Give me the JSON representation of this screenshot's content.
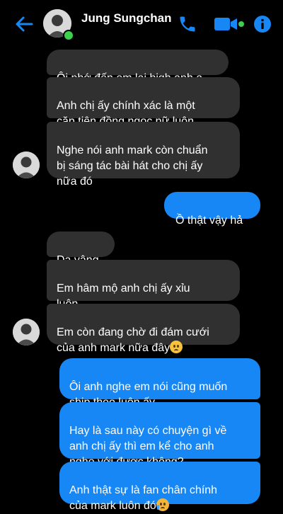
{
  "header": {
    "contact_name": "Jung Sungchan",
    "icons": [
      "back-arrow-icon",
      "phone-icon",
      "video-camera-icon",
      "info-icon"
    ],
    "accent_color": "#1787f5",
    "online_color": "#3ad14d"
  },
  "messages": [
    {
      "side": "in",
      "text": "Ôi nhớ đến em lại high anh ạ"
    },
    {
      "side": "in",
      "text": "Anh chị ấy chính xác là một\ncặp tiên đồng ngọc nữ luôn"
    },
    {
      "side": "in",
      "text": "Nghe nói anh mark còn chuẩn\nbị sáng tác bài hát cho chị ấy\nnữa đó"
    },
    {
      "side": "out",
      "text": "Ồ thật vậy hả"
    },
    {
      "side": "in",
      "text": "Dạ vâng"
    },
    {
      "side": "in",
      "text": "Em hâm mộ anh chị ấy xỉu\nluôn"
    },
    {
      "side": "in",
      "text": "Em còn đang chờ đi đám cưới\ncủa anh mark nữa đây",
      "emoji": "pleading-face-emoji"
    },
    {
      "side": "out",
      "text": "Ôi anh nghe em nói cũng muốn\nship theo luôn ấy"
    },
    {
      "side": "out",
      "text": "Hay là sau này có chuyện gì về\nanh chị ấy thì em kể cho anh\nnghe với được không?"
    },
    {
      "side": "out",
      "text": "Anh thật sự là fan chân chính\ncủa mark luôn đó",
      "emoji": "crying-face-emoji"
    }
  ]
}
